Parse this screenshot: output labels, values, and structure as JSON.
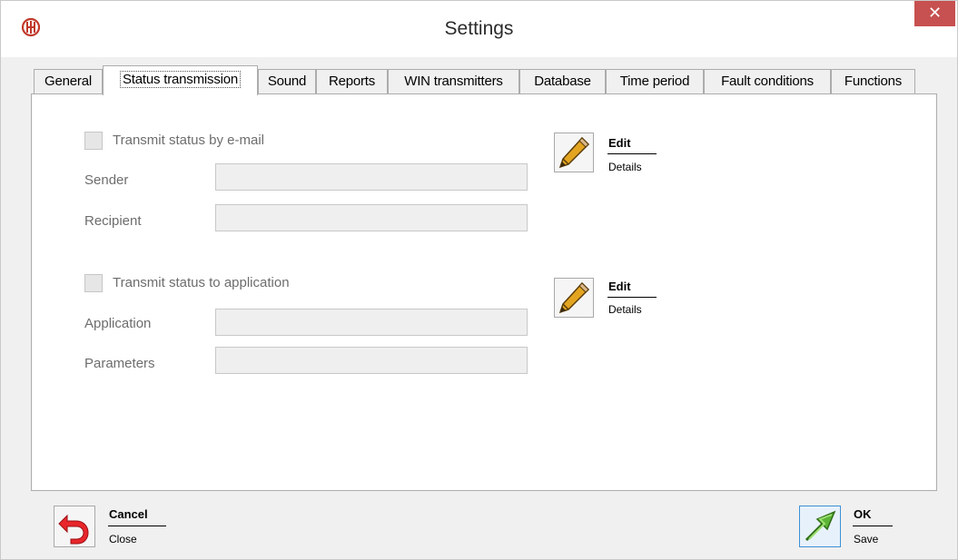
{
  "window": {
    "title": "Settings",
    "close_glyph": "✕",
    "logo_icon": "app-logo-icon",
    "colors": {
      "close_bg": "#c75050",
      "titlebar_bg": "#ffffff",
      "window_bg": "#f0f0f0"
    }
  },
  "tabs": [
    {
      "label": "General",
      "active": false
    },
    {
      "label": "Status transmission",
      "active": true
    },
    {
      "label": "Sound",
      "active": false
    },
    {
      "label": "Reports",
      "active": false
    },
    {
      "label": "WIN transmitters",
      "active": false
    },
    {
      "label": "Database",
      "active": false
    },
    {
      "label": "Time period",
      "active": false
    },
    {
      "label": "Fault conditions",
      "active": false
    },
    {
      "label": "Functions",
      "active": false
    }
  ],
  "email": {
    "checkbox_label": "Transmit status by e-mail",
    "checked": false,
    "sender_label": "Sender",
    "sender_value": "",
    "recipient_label": "Recipient",
    "recipient_value": "",
    "edit_title": "Edit",
    "edit_sub": "Details",
    "edit_icon": "pencil-icon"
  },
  "application": {
    "checkbox_label": "Transmit status to application",
    "checked": false,
    "application_label": "Application",
    "application_value": "",
    "parameters_label": "Parameters",
    "parameters_value": "",
    "edit_title": "Edit",
    "edit_sub": "Details",
    "edit_icon": "pencil-icon"
  },
  "footer": {
    "cancel_title": "Cancel",
    "cancel_sub": "Close",
    "cancel_icon": "undo-arrow-icon",
    "ok_title": "OK",
    "ok_sub": "Save",
    "ok_icon": "green-arrow-icon"
  }
}
